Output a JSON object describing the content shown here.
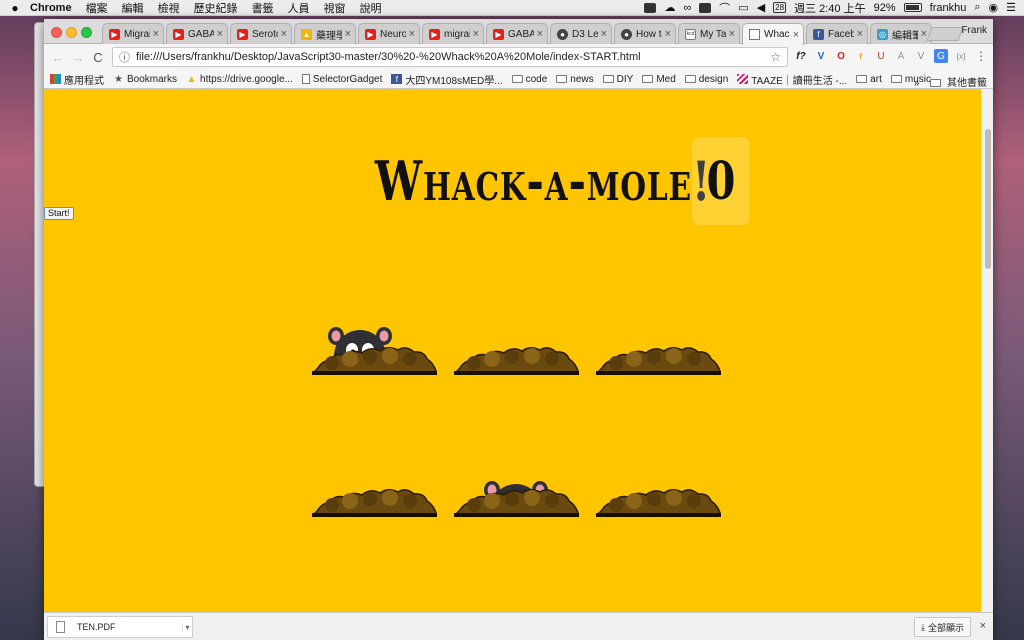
{
  "menubar": {
    "apple": "",
    "app": "Chrome",
    "menus": [
      "檔案",
      "編輯",
      "檢視",
      "歷史紀錄",
      "書籤",
      "人員",
      "視窗",
      "說明"
    ],
    "date_badge": "28",
    "clock": "週三 2:40 上午",
    "battery": "92%",
    "user": "frankhu"
  },
  "tabs": [
    {
      "label": "Migrai",
      "icon": "youtube-icon"
    },
    {
      "label": "GABA",
      "icon": "youtube-icon"
    },
    {
      "label": "Seroto",
      "icon": "youtube-icon"
    },
    {
      "label": "藥理學",
      "icon": "drive-icon"
    },
    {
      "label": "Neuro",
      "icon": "youtube-icon"
    },
    {
      "label": "migrai",
      "icon": "youtube-icon"
    },
    {
      "label": "GABA",
      "icon": "youtube-icon"
    },
    {
      "label": "D3 Le",
      "icon": "github-icon"
    },
    {
      "label": "How to",
      "icon": "github-icon"
    },
    {
      "label": "My Ta",
      "icon": "kcd-icon"
    },
    {
      "label": "Whack",
      "icon": "document-icon"
    },
    {
      "label": "Facebo",
      "icon": "facebook-icon"
    },
    {
      "label": "編輯筆",
      "icon": "globe-icon"
    }
  ],
  "tab_close": "×",
  "profile_name": "Frank",
  "toolbar": {
    "back": "←",
    "forward": "→",
    "reload": "C",
    "url": "file:///Users/frankhu/Desktop/JavaScript30-master/30%20-%20Whack%20A%20Mole/index-START.html",
    "info_icon": "ⓘ",
    "star": "☆",
    "extensions": [
      "f?",
      "V",
      "O",
      "r",
      "U",
      "A",
      "V",
      "G",
      "{x}",
      "⋮"
    ]
  },
  "bookmarks": [
    {
      "label": "應用程式",
      "icon": "apps-icon"
    },
    {
      "label": "Bookmarks",
      "icon": "star-icon"
    },
    {
      "label": "https://drive.google...",
      "icon": "drive-icon"
    },
    {
      "label": "SelectorGadget",
      "icon": "page-icon"
    },
    {
      "label": "大四YM108sMED學...",
      "icon": "facebook-icon"
    },
    {
      "label": "code",
      "icon": "folder-icon"
    },
    {
      "label": "news",
      "icon": "folder-icon"
    },
    {
      "label": "DIY",
      "icon": "folder-icon"
    },
    {
      "label": "Med",
      "icon": "folder-icon"
    },
    {
      "label": "design",
      "icon": "folder-icon"
    },
    {
      "label": "TAAZE｜讀冊生活 -...",
      "icon": "taaze-icon"
    },
    {
      "label": "art",
      "icon": "folder-icon"
    },
    {
      "label": "music",
      "icon": "folder-icon"
    }
  ],
  "bookmarks_more": "»",
  "bookmarks_other": "其他書籤",
  "game": {
    "title": "Whack-a-mole!",
    "score": "0",
    "start_label": "Start!",
    "holes": [
      {
        "row": 1,
        "col": 1,
        "mole_visible": true,
        "mole_level": 0.9
      },
      {
        "row": 1,
        "col": 2,
        "mole_visible": false,
        "mole_level": 0
      },
      {
        "row": 1,
        "col": 3,
        "mole_visible": false,
        "mole_level": 0
      },
      {
        "row": 2,
        "col": 1,
        "mole_visible": false,
        "mole_level": 0
      },
      {
        "row": 2,
        "col": 2,
        "mole_visible": true,
        "mole_level": 0.5
      },
      {
        "row": 2,
        "col": 3,
        "mole_visible": false,
        "mole_level": 0
      }
    ]
  },
  "downloads": {
    "file_name": "TEN.PDF",
    "dropdown": "▾",
    "show_all": "全部顯示",
    "download_icon": "⤓",
    "close": "×"
  },
  "colors": {
    "game_bg": "#ffc600",
    "dirt": "#6b4a10",
    "mole": "#2f2f36"
  }
}
